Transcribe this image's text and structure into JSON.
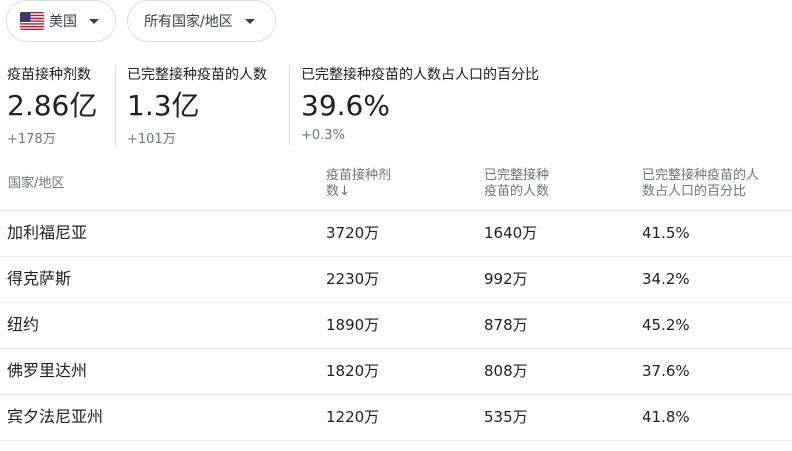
{
  "filters": {
    "country": {
      "label": "美国",
      "flag_icon": "us-flag-icon"
    },
    "region": {
      "label": "所有国家/地区"
    }
  },
  "stats": [
    {
      "title": "疫苗接种剂数",
      "value": "2.86亿",
      "delta": "+178万"
    },
    {
      "title": "已完整接种疫苗的人数",
      "value": "1.3亿",
      "delta": "+101万"
    },
    {
      "title": "已完整接种疫苗的人数占人口的百分比",
      "value": "39.6%",
      "delta": "+0.3%"
    }
  ],
  "table": {
    "headers": {
      "region": "国家/地区",
      "doses_line1": "疫苗接种剂",
      "doses_line2": "数",
      "doses_sort_arrow": "↓",
      "full_line1": "已完整接种",
      "full_line2": "疫苗的人数",
      "pct_line1": "已完整接种疫苗的人",
      "pct_line2": "数占人口的百分比"
    },
    "rows": [
      {
        "region": "加利福尼亚",
        "doses": "3720万",
        "full": "1640万",
        "pct": "41.5%"
      },
      {
        "region": "得克萨斯",
        "doses": "2230万",
        "full": "992万",
        "pct": "34.2%"
      },
      {
        "region": "纽约",
        "doses": "1890万",
        "full": "878万",
        "pct": "45.2%"
      },
      {
        "region": "佛罗里达州",
        "doses": "1820万",
        "full": "808万",
        "pct": "37.6%"
      },
      {
        "region": "宾夕法尼亚州",
        "doses": "1220万",
        "full": "535万",
        "pct": "41.8%"
      }
    ]
  }
}
